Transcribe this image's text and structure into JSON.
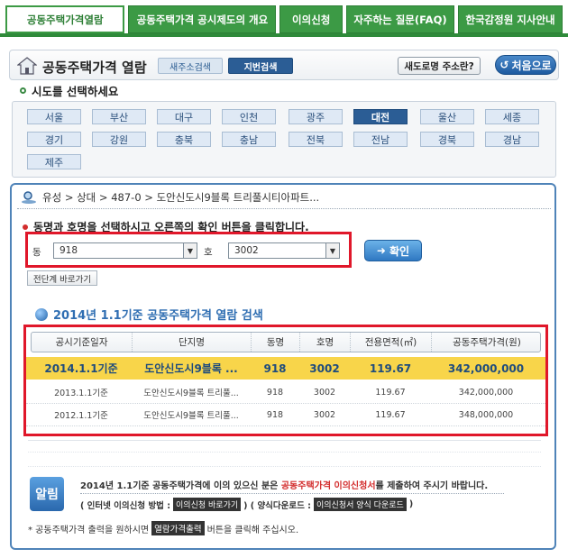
{
  "nav": {
    "tabs": [
      {
        "label": "공동주택가격열람"
      },
      {
        "label": "공동주택가격 공시제도의 개요"
      },
      {
        "label": "이의신청"
      },
      {
        "label": "자주하는 질문(FAQ)"
      },
      {
        "label": "한국감정원 지사안내"
      }
    ]
  },
  "header": {
    "title": "공동주택가격 열람",
    "address_search": "새주소검색",
    "lot_search": "지번검색",
    "road_question": "새도로명 주소란?",
    "home": "처음으로"
  },
  "sido": {
    "title": "시도를 선택하세요",
    "regions": [
      "서울",
      "부산",
      "대구",
      "인천",
      "광주",
      "대전",
      "울산",
      "세종",
      "경기",
      "강원",
      "충북",
      "충남",
      "전북",
      "전남",
      "경북",
      "경남",
      "제주"
    ],
    "selected": "대전"
  },
  "breadcrumb": "유성 > 상대 > 487-0 > 도안신도시9블록 트리풀시티아파트...",
  "select_form": {
    "instruction": "동명과 호명을 선택하시고 오른쪽의 확인 버튼을 클릭합니다.",
    "dong_label": "동",
    "dong_value": "918",
    "ho_label": "호",
    "ho_value": "3002",
    "confirm": "확인",
    "back": "전단계 바로가기"
  },
  "results": {
    "title": "2014년 1.1기준 공동주택가격 열람 검색",
    "columns": [
      "공시기준일자",
      "단지명",
      "동명",
      "호명",
      "전용면적(㎡)",
      "공동주택가격(원)"
    ],
    "rows": [
      {
        "date": "2014.1.1기준",
        "complex": "도안신도시9블록 ...",
        "dong": "918",
        "ho": "3002",
        "area": "119.67",
        "price": "342,000,000"
      },
      {
        "date": "2013.1.1기준",
        "complex": "도안신도시9블록 트리풀...",
        "dong": "918",
        "ho": "3002",
        "area": "119.67",
        "price": "342,000,000"
      },
      {
        "date": "2012.1.1기준",
        "complex": "도안신도시9블록 트리풀...",
        "dong": "918",
        "ho": "3002",
        "area": "119.67",
        "price": "348,000,000"
      }
    ]
  },
  "notice": {
    "badge": "알림",
    "line1_prefix": "2014년 1.1기준 공동주택가격에 이의 있으신 분은",
    "line1_red": "공동주택가격 이의신청서",
    "line1_suffix": "를 제출하여 주시기 바랍니다.",
    "l2_a": "( 인터넷 이의신청 방법 :",
    "l2_tag1": "이의신청 바로가기",
    "l2_b": ") ( 양식다운로드 :",
    "l2_tag2": "이의신청서 양식 다운로드",
    "l2_c": ")"
  },
  "footer": {
    "prefix": "* 공동주택가격 출력을 원하시면",
    "tag": "열람가격출력",
    "suffix": "버튼을 클릭해 주십시오."
  }
}
